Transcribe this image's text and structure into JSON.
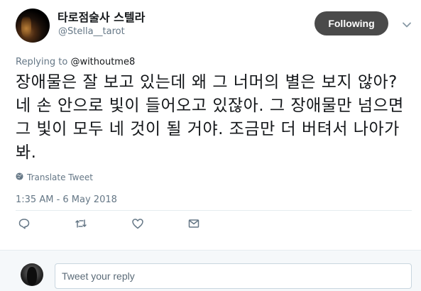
{
  "user": {
    "display_name": "타로점술사 스텔라",
    "handle": "@Stella__tarot"
  },
  "follow_button": {
    "label": "Following"
  },
  "reply_to": {
    "prefix": "Replying to ",
    "mention": "@withoutme8"
  },
  "tweet": {
    "text": "장애물은 잘 보고 있는데 왜 그 너머의 별은 보지 않아? 네 손 안으로 빛이 들어오고 있잖아. 그 장애물만 넘으면 그 빛이 모두 네 것이 될 거야. 조금만 더 버텨서 나아가봐.",
    "translate_label": "Translate Tweet",
    "timestamp": "1:35 AM - 6 May 2018"
  },
  "actions": {
    "icons": [
      "reply-icon",
      "retweet-icon",
      "like-icon",
      "message-icon"
    ]
  },
  "reply_box": {
    "placeholder": "Tweet your reply"
  },
  "colors": {
    "text": "#14171a",
    "muted": "#657786",
    "follow_bg": "#4a4a4a",
    "divider": "#e6ecf0"
  }
}
